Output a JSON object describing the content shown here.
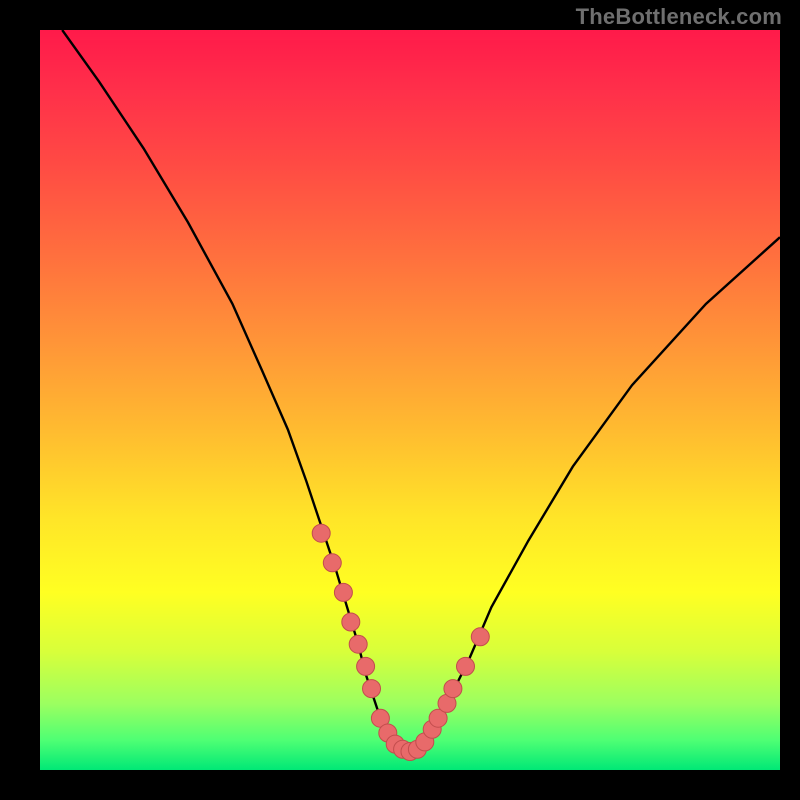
{
  "watermark": "TheBottleneck.com",
  "colors": {
    "background": "#000000",
    "curve_stroke": "#000000",
    "marker_fill": "#e86a6a",
    "marker_stroke": "#c24d4d"
  },
  "chart_data": {
    "type": "line",
    "title": "",
    "xlabel": "",
    "ylabel": "",
    "xlim": [
      0,
      100
    ],
    "ylim": [
      0,
      100
    ],
    "series": [
      {
        "name": "bottleneck-curve",
        "x": [
          3,
          8,
          14,
          20,
          26,
          30,
          33.5,
          36,
          38,
          40,
          41.5,
          43,
          44,
          45,
          46,
          47,
          48,
          49,
          50,
          51,
          52,
          53,
          55,
          58,
          61,
          66,
          72,
          80,
          90,
          100
        ],
        "y": [
          100,
          93,
          84,
          74,
          63,
          54,
          46,
          39,
          33,
          27,
          22,
          17,
          13,
          10,
          7,
          5,
          3.5,
          2.8,
          2.5,
          2.8,
          3.8,
          5.5,
          9,
          15,
          22,
          31,
          41,
          52,
          63,
          72
        ]
      }
    ],
    "markers": {
      "name": "highlighted-points",
      "x": [
        38,
        39.5,
        41,
        42,
        43,
        44,
        44.8,
        46,
        47,
        48,
        49,
        50,
        51,
        52,
        53,
        53.8,
        55,
        55.8,
        57.5,
        59.5
      ],
      "y": [
        32,
        28,
        24,
        20,
        17,
        14,
        11,
        7,
        5,
        3.5,
        2.8,
        2.5,
        2.8,
        3.8,
        5.5,
        7,
        9,
        11,
        14,
        18
      ]
    }
  }
}
